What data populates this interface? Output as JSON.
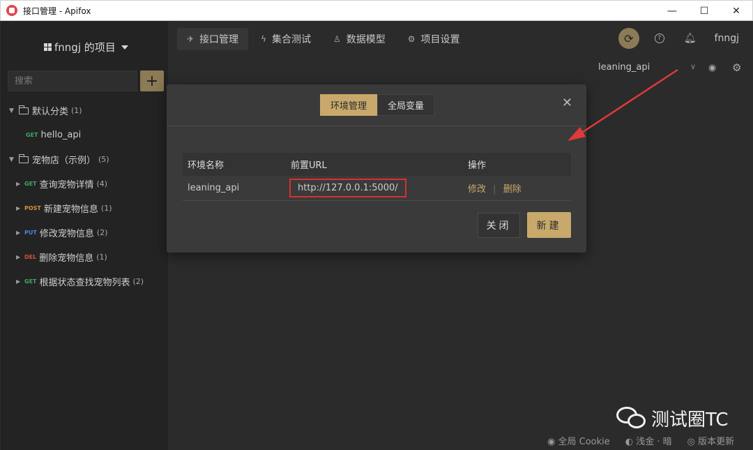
{
  "window": {
    "title": "接口管理 - Apifox",
    "minimize": "—",
    "maximize": "☐",
    "close": "✕"
  },
  "sidebar": {
    "project_name": "fnngj 的项目",
    "search_placeholder": "搜索",
    "add_label": "+",
    "groups": [
      {
        "name": "默认分类",
        "count": "(1)"
      },
      {
        "name": "宠物店（示例）",
        "count": "(5)"
      }
    ],
    "items": [
      {
        "method": "GET",
        "name": "hello_api",
        "count": ""
      },
      {
        "method": "GET",
        "name": "查询宠物详情",
        "count": "(4)"
      },
      {
        "method": "POST",
        "name": "新建宠物信息",
        "count": "(1)"
      },
      {
        "method": "PUT",
        "name": "修改宠物信息",
        "count": "(2)"
      },
      {
        "method": "DEL",
        "name": "删除宠物信息",
        "count": "(1)"
      },
      {
        "method": "GET",
        "name": "根据状态查找宠物列表",
        "count": "(2)"
      }
    ]
  },
  "topnav": {
    "tabs": [
      "接口管理",
      "集合测试",
      "数据模型",
      "项目设置"
    ],
    "user": "fnngj"
  },
  "env_selector": {
    "value": "leaning_api"
  },
  "modal": {
    "tabs": [
      "环境管理",
      "全局变量"
    ],
    "close_icon": "✕",
    "table": {
      "headers": [
        "环境名称",
        "前置URL",
        "操作"
      ],
      "rows": [
        {
          "name": "leaning_api",
          "url": "http://127.0.0.1:5000/",
          "edit": "修改",
          "delete": "删除"
        }
      ]
    },
    "close_button": "关闭",
    "new_button": "新建"
  },
  "watermark": {
    "text": "测试圈TC"
  },
  "statusbar": {
    "cookie": "全局 Cookie",
    "theme": "浅金 · 暗",
    "update": "版本更新"
  },
  "colors": {
    "accent": "#c9a86c",
    "highlight_border": "#d93030",
    "arrow": "#e03a3a"
  }
}
